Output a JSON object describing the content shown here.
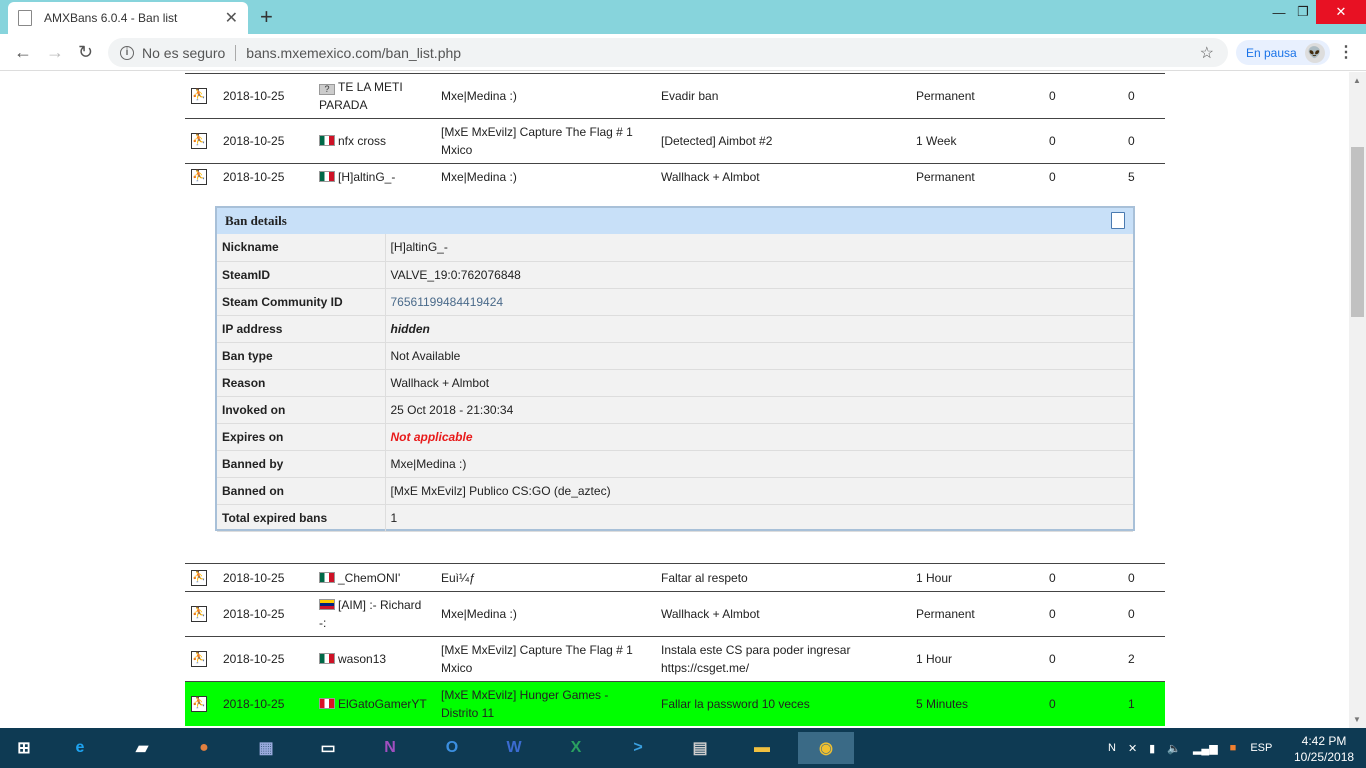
{
  "browser": {
    "tab_title": "AMXBans 6.0.4 - Ban list",
    "new_tab": "+",
    "security": "No es seguro",
    "url": "bans.mxemexico.com/ban_list.php",
    "profile_status": "En pausa",
    "menu": "⋮"
  },
  "bans_top": [
    {
      "date": "2018-10-25",
      "flag": "unk",
      "nick": "TE LA METI PARADA",
      "admin": "Mxe|Medina :)",
      "reason": "Evadir ban",
      "length": "Permanent",
      "n1": "0",
      "n2": "0"
    },
    {
      "date": "2018-10-25",
      "flag": "mx",
      "nick": "nfx cross",
      "admin": "[MxE MxEvilz] Capture The Flag # 1 Mxico",
      "reason": "[Detected] Aimbot #2",
      "length": "1 Week",
      "n1": "0",
      "n2": "0"
    },
    {
      "date": "2018-10-25",
      "flag": "mx",
      "nick": "[H]altinG_-",
      "admin": "Mxe|Medina :)",
      "reason": "Wallhack + Almbot",
      "length": "Permanent",
      "n1": "0",
      "n2": "5"
    }
  ],
  "details": {
    "title": "Ban details",
    "rows": [
      {
        "k": "Nickname",
        "v": "[H]altinG_-"
      },
      {
        "k": "SteamID",
        "v": "VALVE_19:0:762076848"
      },
      {
        "k": "Steam Community ID",
        "v": "76561199484419424"
      },
      {
        "k": "IP address",
        "v": "hidden"
      },
      {
        "k": "Ban type",
        "v": "Not Available"
      },
      {
        "k": "Reason",
        "v": "Wallhack + Almbot"
      },
      {
        "k": "Invoked on",
        "v": "25 Oct 2018 - 21:30:34"
      },
      {
        "k": "Expires on",
        "v": "Not applicable"
      },
      {
        "k": "Banned by",
        "v": "Mxe|Medina :)"
      },
      {
        "k": "Banned on",
        "v": "[MxE MxEvilz] Publico CS:GO (de_aztec)"
      },
      {
        "k": "Total expired bans",
        "v": "1"
      }
    ]
  },
  "bans_bottom": [
    {
      "date": "2018-10-25",
      "flag": "mx",
      "nick": "_ChemONI'",
      "admin": "Euì¼ƒ",
      "reason": "Faltar al respeto",
      "length": "1 Hour",
      "n1": "0",
      "n2": "0"
    },
    {
      "date": "2018-10-25",
      "flag": "ve",
      "nick": "[AIM] :- Richard -:",
      "admin": "Mxe|Medina :)",
      "reason": "Wallhack + Almbot",
      "length": "Permanent",
      "n1": "0",
      "n2": "0"
    },
    {
      "date": "2018-10-25",
      "flag": "mx",
      "nick": "wason13",
      "admin": "[MxE MxEvilz] Capture The Flag # 1 Mxico",
      "reason": "Instala este CS para poder ingresar https://csget.me/",
      "length": "1 Hour",
      "n1": "0",
      "n2": "2"
    },
    {
      "date": "2018-10-25",
      "flag": "pe",
      "nick": "ElGatoGamerYT",
      "admin": "[MxE MxEvilz] Hunger Games - Distrito 11",
      "reason": "Fallar la password 10 veces",
      "length": "5 Minutes",
      "n1": "0",
      "n2": "1"
    }
  ],
  "taskbar": {
    "lang": "ESP",
    "time": "4:42 PM",
    "date": "10/25/2018",
    "apps": [
      "start",
      "ie",
      "tablet",
      "bowl",
      "control-panel",
      "cmd",
      "onenote",
      "outlook",
      "word",
      "excel",
      "powershell",
      "calculator",
      "explorer",
      "chrome"
    ]
  }
}
